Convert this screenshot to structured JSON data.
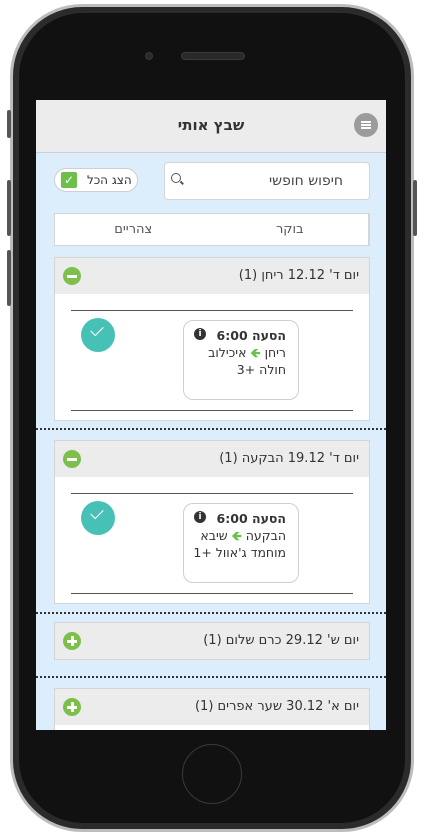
{
  "app": {
    "title": "שבץ אותי"
  },
  "search": {
    "placeholder": "חיפוש חופשי"
  },
  "show_all": {
    "label": "הצג הכל"
  },
  "tabs": [
    {
      "label": "בוקר"
    },
    {
      "label": "צהריים"
    }
  ],
  "days": [
    {
      "header": "יום ד'   12.12   ריחן (1)",
      "expanded": true,
      "ride": {
        "title": "הסעה 6:00",
        "from": "ריחן",
        "to": "איכילוב",
        "passenger": "חולה +3"
      }
    },
    {
      "header": "יום ד'   19.12   הבקעה (1)",
      "expanded": true,
      "ride": {
        "title": "הסעה 6:00",
        "from": "הבקעה",
        "to": "שיבא",
        "passenger": "מוחמד ג'אוול +1"
      }
    },
    {
      "header": "יום ש'   29.12   כרם שלום (1)",
      "expanded": false
    },
    {
      "header": "יום א'   30.12   שער אפרים (1)",
      "expanded": false
    }
  ],
  "colors": {
    "accent_green": "#7cc04b",
    "done_teal": "#47c1b6",
    "screen_bg": "#dceefb"
  },
  "icons": {
    "menu": "hamburger-icon",
    "search": "search-icon",
    "info": "info-icon",
    "done": "check-circle-icon",
    "arrow": "arrow-left-icon"
  }
}
